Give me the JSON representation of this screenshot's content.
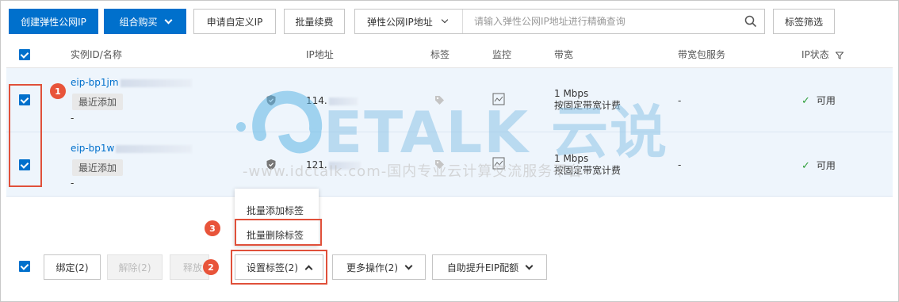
{
  "toolbar": {
    "create_label": "创建弹性公网IP",
    "bundle_label": "组合购买",
    "custom_ip_label": "申请自定义IP",
    "batch_renew_label": "批量续费",
    "tag_filter_label": "标签筛选"
  },
  "search": {
    "field_label": "弹性公网IP地址",
    "placeholder": "请输入弹性公网IP地址进行精确查询"
  },
  "table": {
    "headers": {
      "id_name": "实例ID/名称",
      "ip": "IP地址",
      "tags": "标签",
      "monitor": "监控",
      "bandwidth": "带宽",
      "bandwidth_package": "带宽包服务",
      "status": "IP状态"
    },
    "rows": [
      {
        "id": "eip-bp1jm",
        "chip": "最近添加",
        "name": "-",
        "ip": "114.",
        "bw_speed": "1 Mbps",
        "bw_billing": "按固定带宽计费",
        "package": "-",
        "status": "可用"
      },
      {
        "id": "eip-bp1w",
        "chip": "最近添加",
        "name": "-",
        "ip": "121.",
        "bw_speed": "1 Mbps",
        "bw_billing": "按固定带宽计费",
        "package": "-",
        "status": "可用"
      }
    ]
  },
  "tag_menu": {
    "items": [
      "批量添加标签",
      "批量删除标签"
    ]
  },
  "bottom": {
    "bind_label": "绑定(2)",
    "unbind_label": "解除(2)",
    "release_label": "释放",
    "set_tags_label": "设置标签(2)",
    "more_label": "更多操作(2)",
    "auto_quota_label": "自助提升EIP配额"
  },
  "annotations": [
    "1",
    "2",
    "3"
  ],
  "watermark": {
    "brand": "ETALK 云说",
    "url": "-www.idctalk.com-国内专业云计算交流服务平台-"
  },
  "colors": {
    "primary": "#0070cc",
    "highlight": "#e0503a",
    "row_selected": "#eef5fc",
    "ok": "#2e9e3a"
  }
}
